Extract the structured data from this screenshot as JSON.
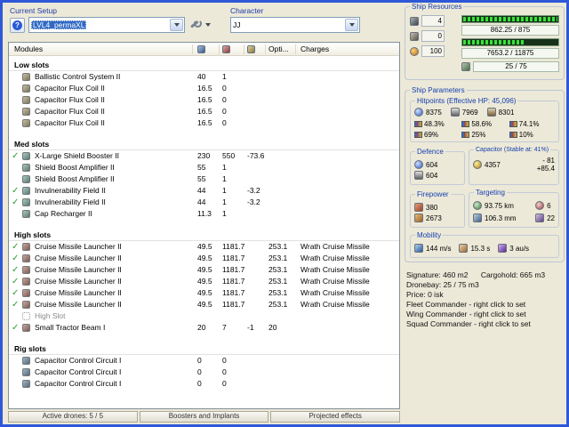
{
  "colors": {
    "selection": "#316ac5",
    "active_check": "#2f9e2f",
    "resource_bar_green": "#3ce03c"
  },
  "topbar": {
    "setup_label": "Current Setup",
    "setup_value": "LVL4_permaXL",
    "character_label": "Character",
    "character_value": "JJ"
  },
  "modules": {
    "title": "Modules",
    "col_opti": "Opti...",
    "col_charges": "Charges",
    "sections": [
      {
        "title": "Low slots",
        "rows": [
          {
            "active": false,
            "name": "Ballistic Control System II",
            "cpu": "40",
            "pg": "1"
          },
          {
            "active": false,
            "name": "Capacitor Flux Coil II",
            "cpu": "16.5",
            "pg": "0"
          },
          {
            "active": false,
            "name": "Capacitor Flux Coil II",
            "cpu": "16.5",
            "pg": "0"
          },
          {
            "active": false,
            "name": "Capacitor Flux Coil II",
            "cpu": "16.5",
            "pg": "0"
          },
          {
            "active": false,
            "name": "Capacitor Flux Coil II",
            "cpu": "16.5",
            "pg": "0"
          }
        ]
      },
      {
        "title": "Med slots",
        "rows": [
          {
            "active": true,
            "name": "X-Large Shield Booster II",
            "cpu": "230",
            "pg": "550",
            "cap": "-73.6"
          },
          {
            "active": false,
            "name": "Shield Boost Amplifier II",
            "cpu": "55",
            "pg": "1"
          },
          {
            "active": false,
            "name": "Shield Boost Amplifier II",
            "cpu": "55",
            "pg": "1"
          },
          {
            "active": true,
            "name": "Invulnerability Field II",
            "cpu": "44",
            "pg": "1",
            "cap": "-3.2"
          },
          {
            "active": true,
            "name": "Invulnerability Field II",
            "cpu": "44",
            "pg": "1",
            "cap": "-3.2"
          },
          {
            "active": false,
            "name": "Cap Recharger II",
            "cpu": "11.3",
            "pg": "1"
          }
        ]
      },
      {
        "title": "High slots",
        "rows": [
          {
            "active": true,
            "name": "Cruise Missile Launcher II",
            "cpu": "49.5",
            "pg": "1181.7",
            "opti": "253.1",
            "charge": "Wrath Cruise Missile"
          },
          {
            "active": true,
            "name": "Cruise Missile Launcher II",
            "cpu": "49.5",
            "pg": "1181.7",
            "opti": "253.1",
            "charge": "Wrath Cruise Missile"
          },
          {
            "active": true,
            "name": "Cruise Missile Launcher II",
            "cpu": "49.5",
            "pg": "1181.7",
            "opti": "253.1",
            "charge": "Wrath Cruise Missile"
          },
          {
            "active": true,
            "name": "Cruise Missile Launcher II",
            "cpu": "49.5",
            "pg": "1181.7",
            "opti": "253.1",
            "charge": "Wrath Cruise Missile"
          },
          {
            "active": true,
            "name": "Cruise Missile Launcher II",
            "cpu": "49.5",
            "pg": "1181.7",
            "opti": "253.1",
            "charge": "Wrath Cruise Missile"
          },
          {
            "active": true,
            "name": "Cruise Missile Launcher II",
            "cpu": "49.5",
            "pg": "1181.7",
            "opti": "253.1",
            "charge": "Wrath Cruise Missile"
          },
          {
            "active": false,
            "name": "High Slot",
            "empty": true
          },
          {
            "active": true,
            "name": "Small Tractor Beam I",
            "cpu": "20",
            "pg": "7",
            "cap": "-1",
            "opti": "20"
          }
        ]
      },
      {
        "title": "Rig slots",
        "rows": [
          {
            "active": false,
            "name": "Capacitor Control Circuit I",
            "cpu": "0",
            "pg": "0"
          },
          {
            "active": false,
            "name": "Capacitor Control Circuit I",
            "cpu": "0",
            "pg": "0"
          },
          {
            "active": false,
            "name": "Capacitor Control Circuit I",
            "cpu": "0",
            "pg": "0"
          }
        ]
      }
    ],
    "footer": {
      "drones": "Active drones: 5 / 5",
      "boosters": "Boosters and Implants",
      "projected": "Projected effects"
    }
  },
  "resources": {
    "title": "Ship Resources",
    "turrets": "4",
    "launchers": "0",
    "calibration": "100",
    "cpu_text": "862.25 / 875",
    "cpu_pct": 98.5,
    "pg_text": "7653.2 / 11875",
    "pg_pct": 64.4,
    "drone_text": "25 / 75"
  },
  "parameters": {
    "title": "Ship Parameters",
    "hitpoints": {
      "title": "Hitpoints (Effective HP: 45,096)",
      "shield": "8375",
      "armor": "7969",
      "hull": "8301",
      "resists": [
        "48.3%",
        "58.6%",
        "74.1%",
        "69%",
        "25%",
        "10%"
      ]
    },
    "defence": {
      "title": "Defence",
      "shield_rate": "604",
      "armor_rate": "604"
    },
    "capacitor": {
      "title": "Capacitor (Stable at: 41%)",
      "amount": "4357",
      "drain": "- 81",
      "recharge": "+85.4"
    },
    "firepower": {
      "title": "Firepower",
      "dps": "380",
      "volley": "2673"
    },
    "targeting": {
      "title": "Targeting",
      "range": "93.75 km",
      "max_targets": "6",
      "scan_resolution": "106.3 mm",
      "sensor_strength": "22"
    },
    "mobility": {
      "title": "Mobility",
      "speed": "144 m/s",
      "agility": "15.3 s",
      "warp_speed": "3 au/s"
    }
  },
  "info": {
    "signature": "Signature: 460 m2",
    "cargohold": "Cargohold: 665 m3",
    "dronebay": "Dronebay: 25 / 75 m3",
    "price": "Price: 0 isk",
    "fleet": "Fleet Commander - right click to set",
    "wing": "Wing Commander - right click to set",
    "squad": "Squad Commander - right click to set"
  }
}
